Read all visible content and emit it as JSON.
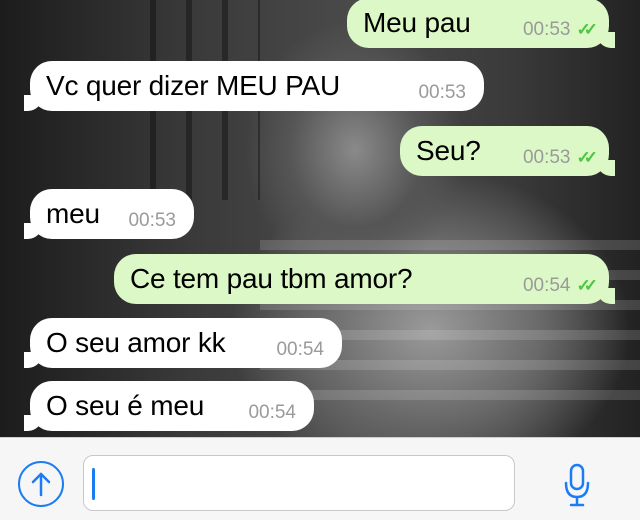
{
  "messages": [
    {
      "direction": "out",
      "text": "Meu pau",
      "time": "00:53",
      "ticks": "✓✓"
    },
    {
      "direction": "in",
      "text": "Vc quer dizer MEU PAU",
      "time": "00:53"
    },
    {
      "direction": "out",
      "text": "Seu?",
      "time": "00:53",
      "ticks": "✓✓"
    },
    {
      "direction": "in",
      "text": "meu",
      "time": "00:53"
    },
    {
      "direction": "out",
      "text": "Ce tem pau tbm amor?",
      "time": "00:54",
      "ticks": "✓✓"
    },
    {
      "direction": "in",
      "text": "O seu amor kk",
      "time": "00:54"
    },
    {
      "direction": "in",
      "text": "O seu é meu",
      "time": "00:54"
    }
  ],
  "input_bar": {
    "message_value": "",
    "attach_icon": "upload-arrow-icon",
    "mic_icon": "microphone-icon"
  },
  "colors": {
    "outgoing_bubble": "#dcf8c6",
    "incoming_bubble": "#ffffff",
    "read_ticks": "#4cc73f",
    "accent": "#1b7cf4"
  }
}
